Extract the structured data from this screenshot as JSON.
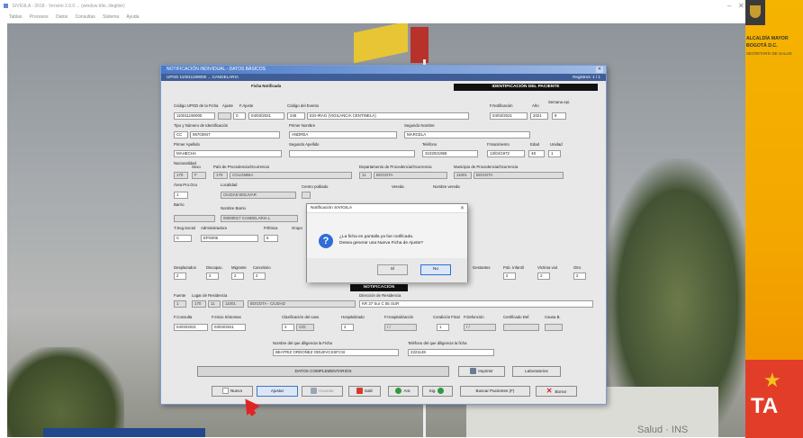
{
  "app": {
    "title": "SIVIGILA - 2018 - Versión 2.0.0 ... (window title, illegible)",
    "menu": [
      "Tablas",
      "Procesos",
      "Datos",
      "Consultas",
      "Sistema",
      "Ayuda"
    ],
    "win_minimize": "–",
    "win_close": "✕"
  },
  "brand": {
    "line1": "ALCALDÍA MAYOR",
    "line2": "BOGOTÁ D.C.",
    "line3": "SECRETARÍA DE SALUD",
    "ta": "TA"
  },
  "dialog": {
    "title": "NOTIFICACIÓN INDIVIDUAL - DATOS BÁSICOS",
    "subtitle": "UPGD 110011190000 ... CANDELARIA",
    "registro": "Registros: 1 / 1",
    "ficha_notificada": "Ficha Notificada",
    "identificacion_header": "IDENTIFICACIÓN DEL PACIENTE",
    "fields": {
      "codigo_upgd_label": "Código UPGD de la Ficha",
      "codigo_upgd": "110011190000",
      "ajuste_label": "Ajuste",
      "ajuste": "0",
      "f_ajuste_label": "F.Ajuste",
      "f_ajuste": "04/03/2021",
      "codigo_evento_label": "Código del Evento",
      "codigo_evento": "345",
      "evento_nombre": "ESI-IRAG (VIGILANCIA CENTINELA)",
      "f_notificacion_label": "F.Notificación",
      "f_notificacion": "04/03/2021",
      "anio_label": "Año",
      "anio": "2021",
      "semana_label": "Semana epi.",
      "semana": "9",
      "tipo_id_label": "Tipo y Número de Identificación",
      "tipo_id": "CC",
      "num_id": "95703947",
      "primer_nombre_label": "Primer Nombre",
      "primer_nombre": "ANDREA",
      "segundo_nombre_label": "Segundo Nombre",
      "segundo_nombre": "MARCELA",
      "primer_apellido_label": "Primer Apellido",
      "primer_apellido": "MAHECHA",
      "segundo_apellido_label": "Segundo Apellido",
      "segundo_apellido": "",
      "telefono_label": "Teléfono",
      "telefono": "3102021958",
      "f_nacimiento_label": "F.Nacimiento",
      "f_nacimiento": "13/04/1972",
      "edad_label": "Edad",
      "edad": "48",
      "unidad_label": "Unidad",
      "unidad": "1",
      "nacionalidad_label": "Nacionalidad",
      "nacionalidad": "170",
      "sexo_label": "Sexo",
      "sexo": "F",
      "pais_label": "País de Procedencia/Ocurrencia",
      "pais_cod": "170",
      "pais": "COLOMBIA",
      "depto_label": "Departamento de Procedencia/Ocurrencia",
      "depto_cod": "11",
      "depto": "BOGOTA",
      "municipio_label": "Municipio de Procedencia/Ocurrencia",
      "municipio_cod": "11001",
      "municipio": "BOGOTA",
      "area_label": "Área Pro.Ocu",
      "area": "1",
      "localidad_label": "Localidad",
      "localidad": "CIUDAD BOLIVAR",
      "centro_label": "Centro poblado",
      "vereda_label": "Vereda",
      "nombre_vereda_label": "Nombre vereda",
      "barrio_label": "Barrio",
      "barrio_cod": "",
      "nombre_barrio_label": "Nombre Barrio",
      "nombre_barrio": "00000017 CANDELARIA L",
      "tseg_label": "T.Seg.Social",
      "tseg": "C",
      "administradora_label": "Administradora",
      "administradora": "EPS006",
      "petnica_label": "P.Étnica",
      "petnica": "6",
      "grupo_label": "Grupo",
      "grupo_values": [
        "2",
        "2",
        "2",
        "2"
      ],
      "right_labels": [
        "Desplazados",
        "Discapac.",
        "Migrante",
        "Carcelario",
        "Gestantes",
        "Pob. Infantil",
        "Víctima viol.",
        "Otro"
      ],
      "right_values": [
        "2",
        "2",
        "2"
      ],
      "notificacion_header": "NOTIFICACIÓN",
      "fuente_label": "Fuente",
      "lugar_residencia_label": "Lugar de Residencia",
      "fuente": "1",
      "residencia_pais": "170",
      "residencia_dep": "11",
      "residencia_mun": "11001",
      "residencia_nombre": "BOGOTA - CIUDAD",
      "direccion_label": "Dirección de Residencia",
      "direccion": "KR 27 Sur C 55 SUR",
      "f_consulta_label": "F.Consulta",
      "f_consulta": "04/03/2021",
      "f_inicio_label": "F.Inicio Síntomas",
      "f_inicio": "03/03/2021",
      "clasificacion_label": "Clasificación del caso",
      "clasificacion": "2",
      "clasificacion_b": "C/D",
      "hospitalizado_label": "Hospitalizado",
      "hospitalizado": "2",
      "f_hosp_label": "F.Hospitalización",
      "f_hosp": "/ /",
      "condicion_label": "Condición Final",
      "condicion": "1",
      "f_defuncion_label": "F.Defunción",
      "f_defuncion": "/ /",
      "certificado_label": "Certificado Def.",
      "causa_label": "Causa B.",
      "quien_label": "Nombre del que diligencia la Ficha",
      "quien": "BEATRIZ ORDOÑEZ ODUEVCSSFCSI",
      "tel_quien_label": "Teléfono del que diligencia la ficha",
      "tel_quien": "2221148"
    },
    "datos_complementarios": "DATOS COMPLEMENTARIOS",
    "btn_imprimir": "Imprimir",
    "btn_laboratorios": "Laboratorios",
    "toolbar": {
      "nuevo": "Nuevo",
      "ajustar": "Ajustar",
      "guardar": "Guardar",
      "salir": "Salir",
      "ant": "Ant.",
      "sig": "Sig.",
      "buscar": "Buscar Pacientes (F)",
      "borrar": "Borrar"
    }
  },
  "message": {
    "title": "Notificación SIVIGILA",
    "close": "✕",
    "icon": "?",
    "line1": "¿La ficha en pantalla ya fue notificada.",
    "line2": "Desea generar una Nueva Ficha de Ajuste?",
    "btn_si": "Sí",
    "btn_no": "No"
  },
  "background": {
    "building_sign": "Salud · INS"
  }
}
